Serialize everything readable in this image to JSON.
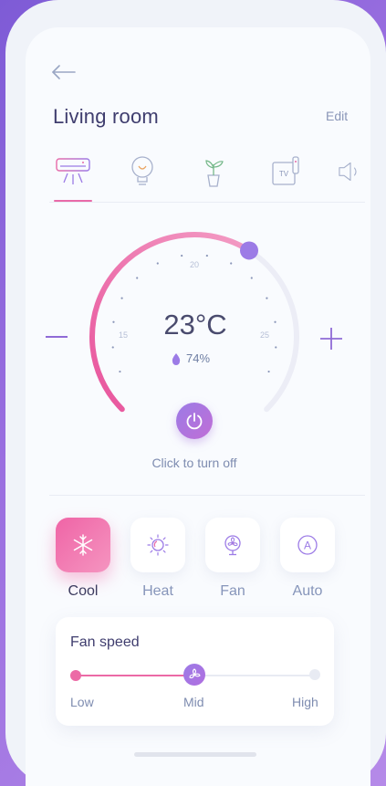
{
  "header": {
    "title": "Living room",
    "edit_label": "Edit"
  },
  "device_tabs": [
    {
      "name": "air-conditioner-icon",
      "selected": true
    },
    {
      "name": "light-bulb-icon",
      "selected": false
    },
    {
      "name": "plant-icon",
      "selected": false
    },
    {
      "name": "tv-remote-icon",
      "selected": false
    },
    {
      "name": "speaker-icon",
      "selected": false
    }
  ],
  "device_tab_tv_text": "TV",
  "thermostat": {
    "temperature": "23°C",
    "humidity": "74%",
    "ticks": {
      "low": "15",
      "mid": "20",
      "high": "25"
    },
    "setpoint_fraction": 0.62,
    "status_text": "Click to turn off"
  },
  "modes": [
    {
      "label": "Cool",
      "icon": "snowflake-icon",
      "active": true
    },
    {
      "label": "Heat",
      "icon": "sun-icon",
      "active": false
    },
    {
      "label": "Fan",
      "icon": "fan-icon",
      "active": false
    },
    {
      "label": "Auto",
      "icon": "auto-icon",
      "active": false
    }
  ],
  "auto_icon_text": "A",
  "fan_speed": {
    "title": "Fan speed",
    "labels": [
      "Low",
      "Mid",
      "High"
    ],
    "value": "Mid"
  },
  "colors": {
    "accent_pink": "#ec6aa6",
    "accent_purple": "#9c7be6",
    "title": "#3f3d6e"
  }
}
